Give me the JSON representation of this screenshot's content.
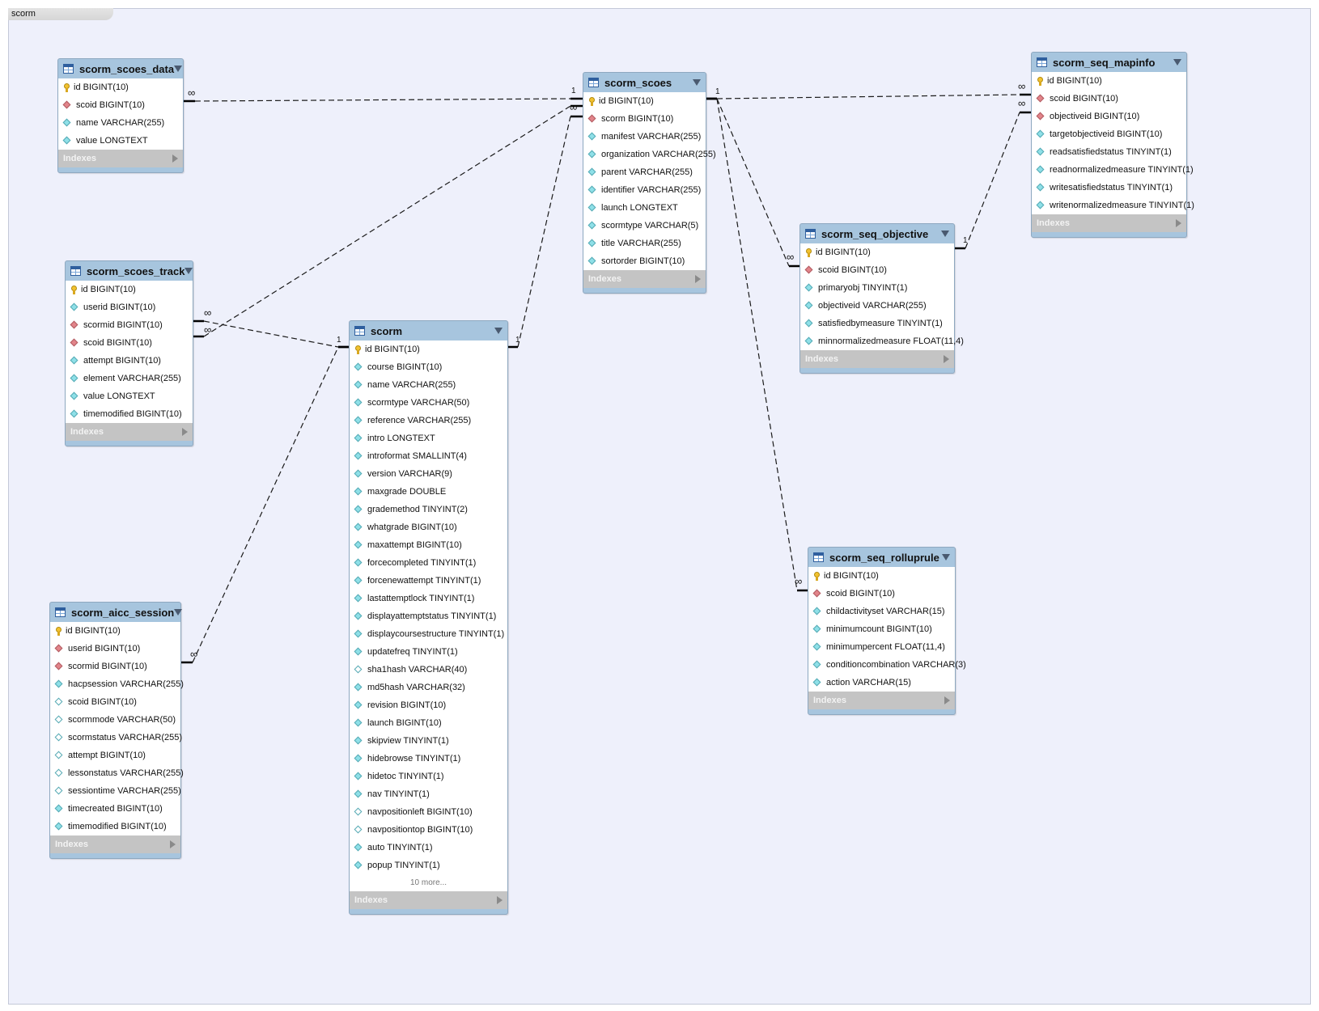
{
  "diagram_tab": "scorm",
  "indexes_label": "Indexes",
  "colors": {
    "canvas": "#eef0fb",
    "header": "#a7c5de",
    "footer": "#c4c4c4",
    "pk": "#f2c230",
    "fk": "#e2848a",
    "attr": "#8fe0e8"
  },
  "tables": {
    "scoes_data": {
      "name": "scorm_scoes_data",
      "columns": [
        {
          "text": "id BIGINT(10)",
          "icon": "key-icon"
        },
        {
          "text": "scoid BIGINT(10)",
          "icon": "fk-icon"
        },
        {
          "text": "name VARCHAR(255)",
          "icon": "attr-icon"
        },
        {
          "text": "value LONGTEXT",
          "icon": "attr-icon"
        }
      ]
    },
    "scoes_track": {
      "name": "scorm_scoes_track",
      "columns": [
        {
          "text": "id BIGINT(10)",
          "icon": "key-icon"
        },
        {
          "text": "userid BIGINT(10)",
          "icon": "attr-icon"
        },
        {
          "text": "scormid BIGINT(10)",
          "icon": "fk-icon"
        },
        {
          "text": "scoid BIGINT(10)",
          "icon": "fk-icon"
        },
        {
          "text": "attempt BIGINT(10)",
          "icon": "attr-icon"
        },
        {
          "text": "element VARCHAR(255)",
          "icon": "attr-icon"
        },
        {
          "text": "value LONGTEXT",
          "icon": "attr-icon"
        },
        {
          "text": "timemodified BIGINT(10)",
          "icon": "attr-icon"
        }
      ]
    },
    "aicc_session": {
      "name": "scorm_aicc_session",
      "columns": [
        {
          "text": "id BIGINT(10)",
          "icon": "key-icon"
        },
        {
          "text": "userid BIGINT(10)",
          "icon": "fk-icon"
        },
        {
          "text": "scormid BIGINT(10)",
          "icon": "fk-icon"
        },
        {
          "text": "hacpsession VARCHAR(255)",
          "icon": "attr-icon"
        },
        {
          "text": "scoid BIGINT(10)",
          "icon": "attr-open-icon"
        },
        {
          "text": "scormmode VARCHAR(50)",
          "icon": "attr-open-icon"
        },
        {
          "text": "scormstatus VARCHAR(255)",
          "icon": "attr-open-icon"
        },
        {
          "text": "attempt BIGINT(10)",
          "icon": "attr-open-icon"
        },
        {
          "text": "lessonstatus VARCHAR(255)",
          "icon": "attr-open-icon"
        },
        {
          "text": "sessiontime VARCHAR(255)",
          "icon": "attr-open-icon"
        },
        {
          "text": "timecreated BIGINT(10)",
          "icon": "attr-icon"
        },
        {
          "text": "timemodified BIGINT(10)",
          "icon": "attr-icon"
        }
      ]
    },
    "scorm": {
      "name": "scorm",
      "more": "10 more...",
      "columns": [
        {
          "text": "id BIGINT(10)",
          "icon": "key-icon"
        },
        {
          "text": "course BIGINT(10)",
          "icon": "attr-icon"
        },
        {
          "text": "name VARCHAR(255)",
          "icon": "attr-icon"
        },
        {
          "text": "scormtype VARCHAR(50)",
          "icon": "attr-icon"
        },
        {
          "text": "reference VARCHAR(255)",
          "icon": "attr-icon"
        },
        {
          "text": "intro LONGTEXT",
          "icon": "attr-icon"
        },
        {
          "text": "introformat SMALLINT(4)",
          "icon": "attr-icon"
        },
        {
          "text": "version VARCHAR(9)",
          "icon": "attr-icon"
        },
        {
          "text": "maxgrade DOUBLE",
          "icon": "attr-icon"
        },
        {
          "text": "grademethod TINYINT(2)",
          "icon": "attr-icon"
        },
        {
          "text": "whatgrade BIGINT(10)",
          "icon": "attr-icon"
        },
        {
          "text": "maxattempt BIGINT(10)",
          "icon": "attr-icon"
        },
        {
          "text": "forcecompleted TINYINT(1)",
          "icon": "attr-icon"
        },
        {
          "text": "forcenewattempt TINYINT(1)",
          "icon": "attr-icon"
        },
        {
          "text": "lastattemptlock TINYINT(1)",
          "icon": "attr-icon"
        },
        {
          "text": "displayattemptstatus TINYINT(1)",
          "icon": "attr-icon"
        },
        {
          "text": "displaycoursestructure TINYINT(1)",
          "icon": "attr-icon"
        },
        {
          "text": "updatefreq TINYINT(1)",
          "icon": "attr-icon"
        },
        {
          "text": "sha1hash VARCHAR(40)",
          "icon": "attr-open-icon"
        },
        {
          "text": "md5hash VARCHAR(32)",
          "icon": "attr-icon"
        },
        {
          "text": "revision BIGINT(10)",
          "icon": "attr-icon"
        },
        {
          "text": "launch BIGINT(10)",
          "icon": "attr-icon"
        },
        {
          "text": "skipview TINYINT(1)",
          "icon": "attr-icon"
        },
        {
          "text": "hidebrowse TINYINT(1)",
          "icon": "attr-icon"
        },
        {
          "text": "hidetoc TINYINT(1)",
          "icon": "attr-icon"
        },
        {
          "text": "nav TINYINT(1)",
          "icon": "attr-icon"
        },
        {
          "text": "navpositionleft BIGINT(10)",
          "icon": "attr-open-icon"
        },
        {
          "text": "navpositiontop BIGINT(10)",
          "icon": "attr-open-icon"
        },
        {
          "text": "auto TINYINT(1)",
          "icon": "attr-icon"
        },
        {
          "text": "popup TINYINT(1)",
          "icon": "attr-icon"
        }
      ]
    },
    "scoes": {
      "name": "scorm_scoes",
      "columns": [
        {
          "text": "id BIGINT(10)",
          "icon": "key-icon"
        },
        {
          "text": "scorm BIGINT(10)",
          "icon": "fk-icon"
        },
        {
          "text": "manifest VARCHAR(255)",
          "icon": "attr-icon"
        },
        {
          "text": "organization VARCHAR(255)",
          "icon": "attr-icon"
        },
        {
          "text": "parent VARCHAR(255)",
          "icon": "attr-icon"
        },
        {
          "text": "identifier VARCHAR(255)",
          "icon": "attr-icon"
        },
        {
          "text": "launch LONGTEXT",
          "icon": "attr-icon"
        },
        {
          "text": "scormtype VARCHAR(5)",
          "icon": "attr-icon"
        },
        {
          "text": "title VARCHAR(255)",
          "icon": "attr-icon"
        },
        {
          "text": "sortorder BIGINT(10)",
          "icon": "attr-icon"
        }
      ]
    },
    "seq_mapinfo": {
      "name": "scorm_seq_mapinfo",
      "columns": [
        {
          "text": "id BIGINT(10)",
          "icon": "key-icon"
        },
        {
          "text": "scoid BIGINT(10)",
          "icon": "fk-icon"
        },
        {
          "text": "objectiveid BIGINT(10)",
          "icon": "fk-icon"
        },
        {
          "text": "targetobjectiveid BIGINT(10)",
          "icon": "attr-icon"
        },
        {
          "text": "readsatisfiedstatus TINYINT(1)",
          "icon": "attr-icon"
        },
        {
          "text": "readnormalizedmeasure TINYINT(1)",
          "icon": "attr-icon"
        },
        {
          "text": "writesatisfiedstatus TINYINT(1)",
          "icon": "attr-icon"
        },
        {
          "text": "writenormalizedmeasure TINYINT(1)",
          "icon": "attr-icon"
        }
      ]
    },
    "seq_objective": {
      "name": "scorm_seq_objective",
      "columns": [
        {
          "text": "id BIGINT(10)",
          "icon": "key-icon"
        },
        {
          "text": "scoid BIGINT(10)",
          "icon": "fk-icon"
        },
        {
          "text": "primaryobj TINYINT(1)",
          "icon": "attr-icon"
        },
        {
          "text": "objectiveid VARCHAR(255)",
          "icon": "attr-icon"
        },
        {
          "text": "satisfiedbymeasure TINYINT(1)",
          "icon": "attr-icon"
        },
        {
          "text": "minnormalizedmeasure FLOAT(11,4)",
          "icon": "attr-icon"
        }
      ]
    },
    "seq_rolluprule": {
      "name": "scorm_seq_rolluprule",
      "columns": [
        {
          "text": "id BIGINT(10)",
          "icon": "key-icon"
        },
        {
          "text": "scoid BIGINT(10)",
          "icon": "fk-icon"
        },
        {
          "text": "childactivityset VARCHAR(15)",
          "icon": "attr-icon"
        },
        {
          "text": "minimumcount BIGINT(10)",
          "icon": "attr-icon"
        },
        {
          "text": "minimumpercent FLOAT(11,4)",
          "icon": "attr-icon"
        },
        {
          "text": "conditioncombination VARCHAR(3)",
          "icon": "attr-icon"
        },
        {
          "text": "action VARCHAR(15)",
          "icon": "attr-icon"
        }
      ]
    }
  },
  "relationships": [
    {
      "from": "scoes_data",
      "to": "scoes",
      "from_card": "∞",
      "to_card": "1"
    },
    {
      "from": "scoes_track",
      "to": "scoes",
      "from_card": "∞",
      "to_card": "∞"
    },
    {
      "from": "scoes_track",
      "to": "scorm",
      "from_card": "∞",
      "to_card": "1"
    },
    {
      "from": "aicc_session",
      "to": "scorm",
      "from_card": "∞",
      "to_card": ""
    },
    {
      "from": "scoes",
      "to": "scorm",
      "from_card": "",
      "to_card": "1"
    },
    {
      "from": "scoes",
      "to": "seq_mapinfo",
      "from_card": "1",
      "to_card": "∞"
    },
    {
      "from": "scoes",
      "to": "seq_objective",
      "from_card": "",
      "to_card": "∞"
    },
    {
      "from": "scoes",
      "to": "seq_rolluprule",
      "from_card": "",
      "to_card": "∞"
    },
    {
      "from": "seq_objective",
      "to": "seq_mapinfo",
      "from_card": "1",
      "to_card": "∞"
    }
  ]
}
